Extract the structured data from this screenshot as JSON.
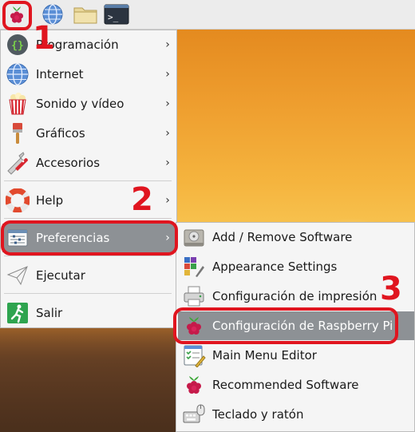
{
  "taskbar": {
    "buttons": [
      {
        "icon": "raspberry-icon"
      },
      {
        "icon": "globe-icon"
      },
      {
        "icon": "folder-icon"
      },
      {
        "icon": "terminal-icon",
        "glyph": ">_"
      }
    ]
  },
  "menu": {
    "items": [
      {
        "label": "Programación",
        "icon": "braces-icon",
        "has_submenu": true
      },
      {
        "label": "Internet",
        "icon": "globe-icon",
        "has_submenu": true
      },
      {
        "label": "Sonido y vídeo",
        "icon": "popcorn-icon",
        "has_submenu": true
      },
      {
        "label": "Gráficos",
        "icon": "paintbrush-icon",
        "has_submenu": true
      },
      {
        "label": "Accesorios",
        "icon": "pocketknife-icon",
        "has_submenu": true
      },
      {
        "label": "Help",
        "icon": "lifebuoy-icon",
        "has_submenu": true
      },
      {
        "label": "Preferencias",
        "icon": "preferences-icon",
        "has_submenu": true,
        "active": true
      },
      {
        "label": "Ejecutar",
        "icon": "paper-plane-icon",
        "has_submenu": false
      },
      {
        "label": "Salir",
        "icon": "exit-icon",
        "has_submenu": false
      }
    ],
    "arrow": "›"
  },
  "submenu": {
    "items": [
      {
        "label": "Add / Remove Software",
        "icon": "package-icon"
      },
      {
        "label": "Appearance Settings",
        "icon": "appearance-icon"
      },
      {
        "label": "Configuración de impresión",
        "icon": "printer-icon"
      },
      {
        "label": "Configuración de Raspberry Pi",
        "icon": "raspberry-icon",
        "active": true
      },
      {
        "label": "Main Menu Editor",
        "icon": "menu-editor-icon"
      },
      {
        "label": "Recommended Software",
        "icon": "raspberry-icon"
      },
      {
        "label": "Teclado y ratón",
        "icon": "keyboard-mouse-icon"
      }
    ]
  },
  "annotations": {
    "step1": "1",
    "step2": "2",
    "step3": "3",
    "color": "#e0151f"
  },
  "colors": {
    "menu_bg": "#f5f5f5",
    "highlight": "#8d9195",
    "taskbar": "#ececec"
  }
}
